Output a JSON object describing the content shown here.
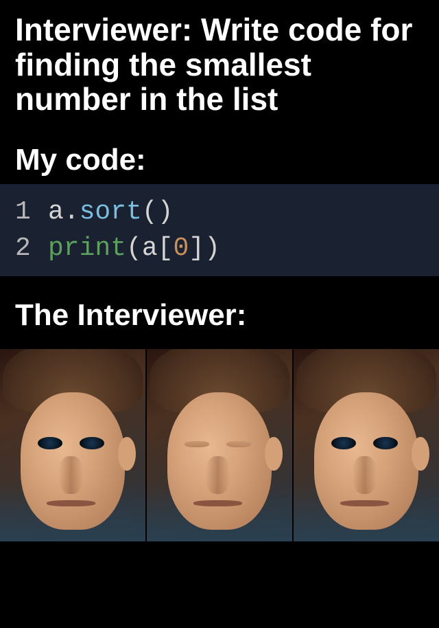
{
  "caption": {
    "top": "Interviewer: Write code for finding the smallest number in the list",
    "my_code": "My code:",
    "interviewer": "The Interviewer:"
  },
  "code": {
    "lines": [
      {
        "num": "1",
        "tokens": [
          {
            "t": "a",
            "c": "tok-var"
          },
          {
            "t": ".",
            "c": "tok-punct"
          },
          {
            "t": "sort",
            "c": "tok-method"
          },
          {
            "t": "()",
            "c": "tok-punct"
          }
        ]
      },
      {
        "num": "2",
        "tokens": [
          {
            "t": "print",
            "c": "tok-func"
          },
          {
            "t": "(a[",
            "c": "tok-punct"
          },
          {
            "t": "0",
            "c": "tok-number"
          },
          {
            "t": "])",
            "c": "tok-punct"
          }
        ]
      }
    ]
  },
  "reaction": {
    "panels": [
      "open",
      "closed",
      "open"
    ],
    "description": "blinking-guy-meme"
  }
}
